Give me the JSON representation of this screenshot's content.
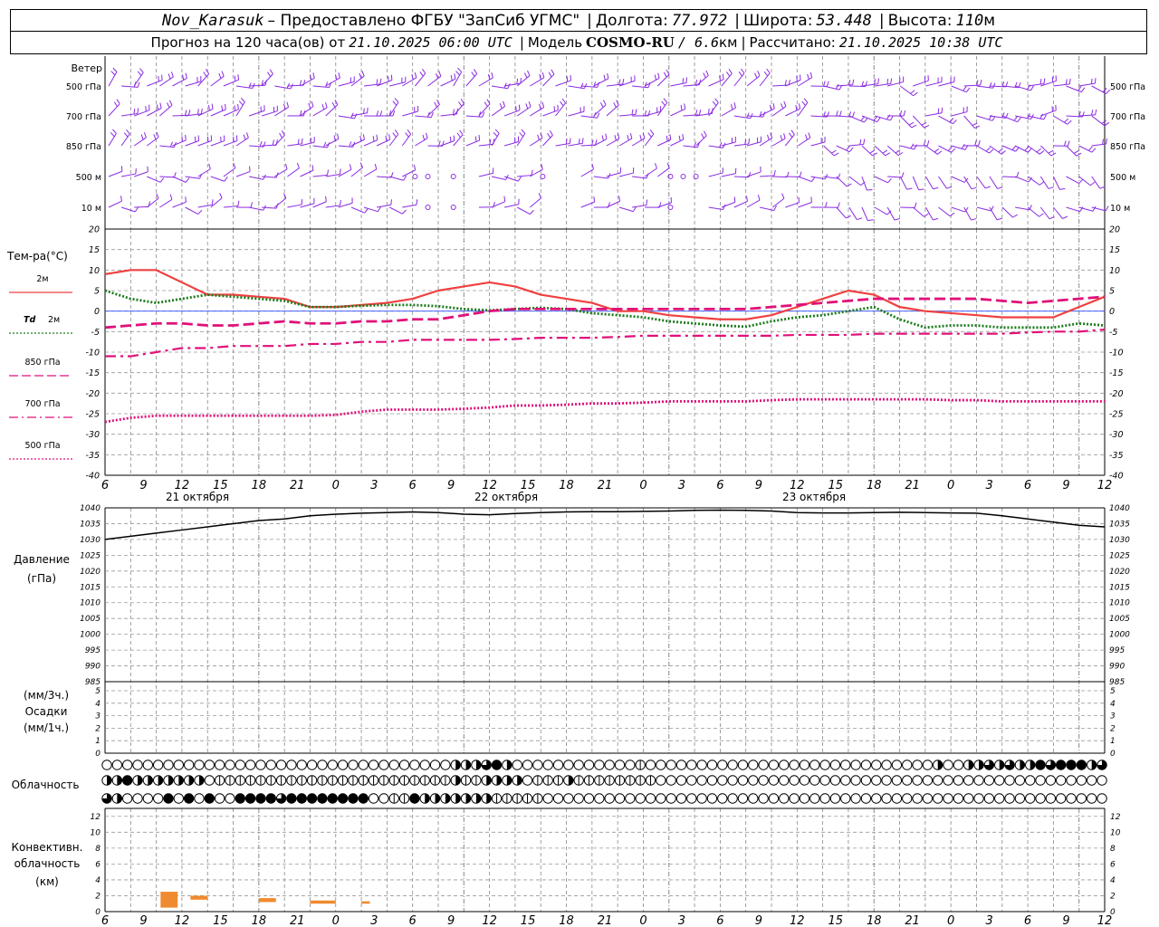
{
  "header": {
    "station": "Nov_Karasuk",
    "provided_by": "– Предоставлено ФГБУ \"ЗапСиб УГМС\"",
    "lon_label": "Долгота:",
    "lon": "77.972",
    "lat_label": "Широта:",
    "lat": "53.448",
    "alt_label": "Высота:",
    "alt": "110",
    "alt_unit": "м",
    "forecast_label": "Прогноз на 120 часа(ов) от",
    "forecast_start": "21.10.2025 06:00 UTC",
    "model_label": "Модель",
    "model_name": "COSMO-RU",
    "model_res": "/ 6.6",
    "model_res_unit": "км",
    "calc_label": "Рассчитано:",
    "calc_time": "21.10.2025 10:38 UTC",
    "sep": "|"
  },
  "panels": {
    "wind": {
      "title": "Ветер",
      "levels": [
        "500 гПа",
        "700 гПа",
        "850 гПа",
        "500 м",
        "10 м"
      ],
      "color": "#8a2be2"
    },
    "temp": {
      "title": "Тем-ра(°C)",
      "legend": [
        {
          "label": "2м",
          "color": "#f04040",
          "style": "solid"
        },
        {
          "label": "Td",
          "label2": "2м",
          "color": "#1a7a1a",
          "style": "dotted"
        },
        {
          "label": "850 гПа",
          "color": "#e0107a",
          "style": "dashed"
        },
        {
          "label": "700 гПа",
          "color": "#e0107a",
          "style": "dashdot"
        },
        {
          "label": "500 гПа",
          "color": "#e0107a",
          "style": "dotted"
        }
      ]
    },
    "pressure": {
      "title": "Давление",
      "unit": "(гПа)"
    },
    "precip": {
      "unit_top": "(мм/3ч.)",
      "title": "Осадки",
      "unit_bottom": "(мм/1ч.)"
    },
    "cloud": {
      "title": "Облачность"
    },
    "conv": {
      "title1": "Конвективн.",
      "title2": "облачность",
      "unit": "(км)",
      "color": "#f08a30"
    }
  },
  "time_axis": {
    "hour_labels": [
      "6",
      "9",
      "12",
      "15",
      "18",
      "21",
      "0",
      "3",
      "6",
      "9",
      "12",
      "15",
      "18",
      "21",
      "0",
      "3",
      "6",
      "9",
      "12",
      "15",
      "18",
      "21",
      "0",
      "3",
      "6",
      "9",
      "12"
    ],
    "dates": [
      "21 октября",
      "22 октября",
      "23 октября"
    ]
  },
  "chart_data": [
    {
      "type": "line",
      "title": "Тем-ра(°C)",
      "ylim": [
        -40,
        20
      ],
      "yticks": [
        20,
        15,
        10,
        5,
        0,
        -5,
        -10,
        -15,
        -20,
        -25,
        -30,
        -35,
        -40
      ],
      "x_hours_from_start": [
        0,
        3,
        6,
        9,
        12,
        15,
        18,
        21,
        24,
        27,
        30,
        33,
        36,
        39,
        42,
        45,
        48,
        51,
        54,
        57,
        60,
        63,
        66,
        69,
        72,
        75,
        78,
        81,
        84,
        87,
        90,
        93,
        96,
        99,
        102,
        105,
        108,
        111,
        114,
        117
      ],
      "series": [
        {
          "name": "2м",
          "values": [
            9,
            10,
            10,
            7,
            4,
            4,
            3.5,
            3,
            1,
            1,
            1.5,
            2,
            3,
            5,
            6,
            7,
            6,
            4,
            3,
            2,
            0,
            0,
            -1,
            -1.5,
            -2,
            -2,
            -1,
            1,
            3,
            5,
            4,
            1,
            0,
            -0.5,
            -1,
            -1.5,
            -1.5,
            -1.5,
            1,
            3.5
          ]
        },
        {
          "name": "Td 2м",
          "values": [
            5,
            3,
            2,
            3,
            4,
            3.5,
            3,
            2.5,
            1,
            1,
            1.3,
            1.5,
            1.5,
            1.2,
            0.5,
            0.2,
            0.5,
            0.8,
            0.5,
            -0.5,
            -1,
            -1.5,
            -2.5,
            -3,
            -3.5,
            -3.8,
            -2.5,
            -1.5,
            -1,
            0,
            1,
            -2,
            -4,
            -3.5,
            -3.5,
            -4,
            -4,
            -4,
            -3,
            -3.5
          ]
        },
        {
          "name": "850 гПа",
          "values": [
            -4,
            -3.5,
            -3,
            -3,
            -3.5,
            -3.5,
            -3,
            -2.5,
            -3,
            -3,
            -2.5,
            -2.5,
            -2,
            -2,
            -1,
            0,
            0.5,
            0.5,
            0.5,
            0.5,
            0.5,
            0.5,
            0.5,
            0.5,
            0.5,
            0.5,
            1,
            1.5,
            2,
            2.5,
            3,
            3,
            3,
            3,
            3,
            2.5,
            2,
            2.5,
            3,
            3.5
          ]
        },
        {
          "name": "700 гПа",
          "values": [
            -11,
            -11,
            -10,
            -9,
            -9,
            -8.5,
            -8.5,
            -8.5,
            -8,
            -8,
            -7.5,
            -7.5,
            -7,
            -7,
            -7,
            -7,
            -6.8,
            -6.5,
            -6.5,
            -6.5,
            -6.3,
            -6,
            -6,
            -6,
            -6,
            -6,
            -6,
            -5.8,
            -5.8,
            -5.8,
            -5.5,
            -5.5,
            -5.5,
            -5.5,
            -5.5,
            -5.5,
            -5.2,
            -5,
            -5,
            -4.5
          ]
        },
        {
          "name": "500 гПа",
          "values": [
            -27,
            -26,
            -25.5,
            -25.5,
            -25.5,
            -25.5,
            -25.5,
            -25.5,
            -25.5,
            -25.3,
            -24.5,
            -24,
            -24,
            -24,
            -23.8,
            -23.5,
            -23,
            -23,
            -22.8,
            -22.5,
            -22.5,
            -22.3,
            -22,
            -22,
            -22,
            -22,
            -21.7,
            -21.5,
            -21.5,
            -21.5,
            -21.5,
            -21.5,
            -21.5,
            -21.7,
            -21.7,
            -22,
            -22,
            -22,
            -22,
            -22
          ]
        }
      ]
    },
    {
      "type": "line",
      "title": "Давление",
      "ylim": [
        985,
        1040
      ],
      "yticks": [
        1040,
        1035,
        1030,
        1025,
        1020,
        1015,
        1010,
        1005,
        1000,
        995,
        990,
        985
      ],
      "x_hours_from_start": [
        0,
        3,
        6,
        9,
        12,
        15,
        18,
        21,
        24,
        27,
        30,
        33,
        36,
        39,
        42,
        45,
        48,
        51,
        54,
        57,
        60,
        63,
        66,
        69,
        72,
        75,
        78,
        81,
        84,
        87,
        90,
        93,
        96,
        99,
        102,
        105,
        108,
        111,
        114,
        117
      ],
      "series": [
        {
          "name": "",
          "values": [
            1030,
            1031,
            1032,
            1033,
            1034,
            1035,
            1036,
            1036.5,
            1037.5,
            1038,
            1038.3,
            1038.5,
            1038.7,
            1038.5,
            1038,
            1037.8,
            1038.2,
            1038.5,
            1038.7,
            1038.8,
            1038.8,
            1038.9,
            1039,
            1039.2,
            1039.3,
            1039.2,
            1039,
            1038.5,
            1038.4,
            1038.4,
            1038.5,
            1038.6,
            1038.5,
            1038.4,
            1038.3,
            1037.5,
            1036.5,
            1035.5,
            1034.5,
            1034
          ]
        }
      ]
    },
    {
      "type": "bar",
      "title": "Осадки",
      "ylim": [
        0,
        5
      ],
      "yticks": [
        5,
        4,
        3,
        2,
        1,
        0
      ],
      "series": [
        {
          "name": "",
          "values": []
        }
      ]
    },
    {
      "type": "bar",
      "title": "Конвективн. облачность",
      "ylim": [
        0,
        13
      ],
      "yticks": [
        12,
        10,
        8,
        6,
        4,
        2,
        0
      ],
      "bars": [
        {
          "hour_start": 6.5,
          "hour_end": 8.5,
          "bottom_km": 0.5,
          "top_km": 2.5
        },
        {
          "hour_start": 10,
          "hour_end": 12,
          "bottom_km": 1.5,
          "top_km": 2
        },
        {
          "hour_start": 18,
          "hour_end": 20,
          "bottom_km": 1.2,
          "top_km": 1.7
        },
        {
          "hour_start": 24,
          "hour_end": 27,
          "bottom_km": 1.0,
          "top_km": 1.4
        },
        {
          "hour_start": 30,
          "hour_end": 31,
          "bottom_km": 1.0,
          "top_km": 1.3
        }
      ]
    }
  ],
  "clouds": {
    "rows": [
      "0000000000000000000000000000000000222342000000000000100000000000000000000000000002002232322434442300",
      "2242222222011111111111111111111111211222201112111111110000000000000000000000000000000000000000000000",
      "3200004040400444434444444400114222222211111000000000000000000000000000000000000000000000000000000000"
    ]
  }
}
